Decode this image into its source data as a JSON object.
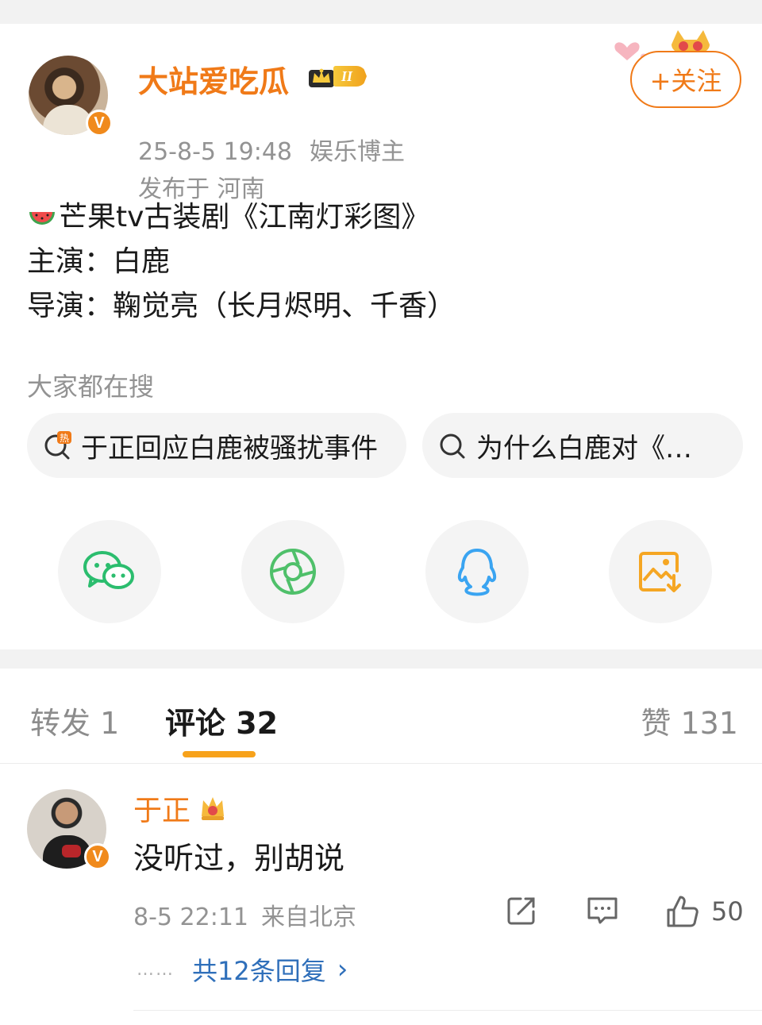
{
  "post": {
    "author": {
      "name": "大站爱吃瓜",
      "level": "II",
      "verified": true
    },
    "timestamp": "25-8-5 19:48",
    "role": "娱乐博主",
    "location": "发布于 河南",
    "follow_label": "+关注",
    "body": {
      "line1": "芒果tv古装剧《江南灯彩图》",
      "line2": "主演：白鹿",
      "line3": "导演：鞠觉亮（长月烬明、千香）"
    }
  },
  "search": {
    "title": "大家都在搜",
    "chips": [
      "于正回应白鹿被骚扰事件",
      "为什么白鹿对《…"
    ]
  },
  "share": {
    "items": [
      "wechat-icon",
      "moments-icon",
      "qq-icon",
      "save-image-icon"
    ]
  },
  "tabs": {
    "repost": "转发 1",
    "comment": "评论 32",
    "like": "赞 131"
  },
  "comment": {
    "author": "于正",
    "text": "没听过，别胡说",
    "time": "8-5 22:11",
    "from": "来自北京",
    "likes": "50",
    "replies_dots": "……",
    "replies_label": "共12条回复",
    "replies_chevron": "›"
  },
  "colors": {
    "accent": "#f07a18",
    "link": "#2f6fba",
    "muted": "#939393",
    "tab_indicator": "#f7a21b"
  }
}
